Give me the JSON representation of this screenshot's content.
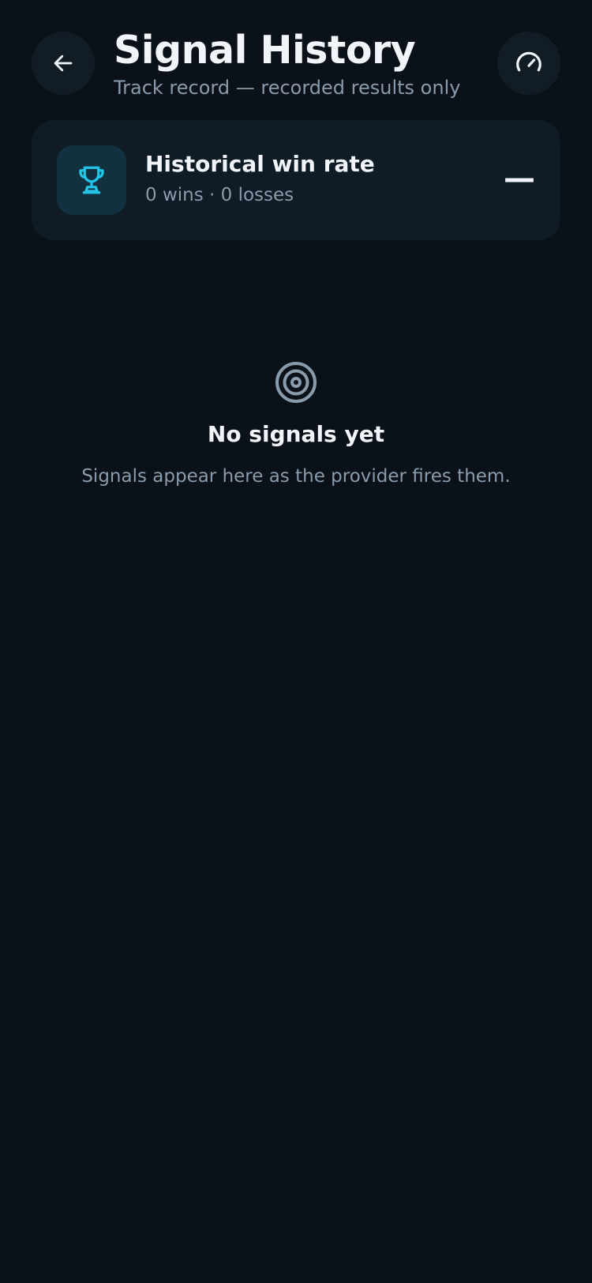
{
  "header": {
    "title": "Signal History",
    "subtitle": "Track record — recorded results only",
    "back_icon": "arrow-left-icon",
    "action_icon": "gauge-icon"
  },
  "winrate": {
    "icon": "trophy-icon",
    "title": "Historical win rate",
    "summary": "0 wins · 0 losses",
    "value": "—"
  },
  "empty_state": {
    "icon": "target-icon",
    "title": "No signals yet",
    "message": "Signals appear here as the provider fires them."
  },
  "colors": {
    "background": "#0a1118",
    "card": "#0f1c26",
    "accent": "#22c3e6",
    "muted_text": "#8a9bab",
    "primary_text": "#f1f5f9"
  }
}
